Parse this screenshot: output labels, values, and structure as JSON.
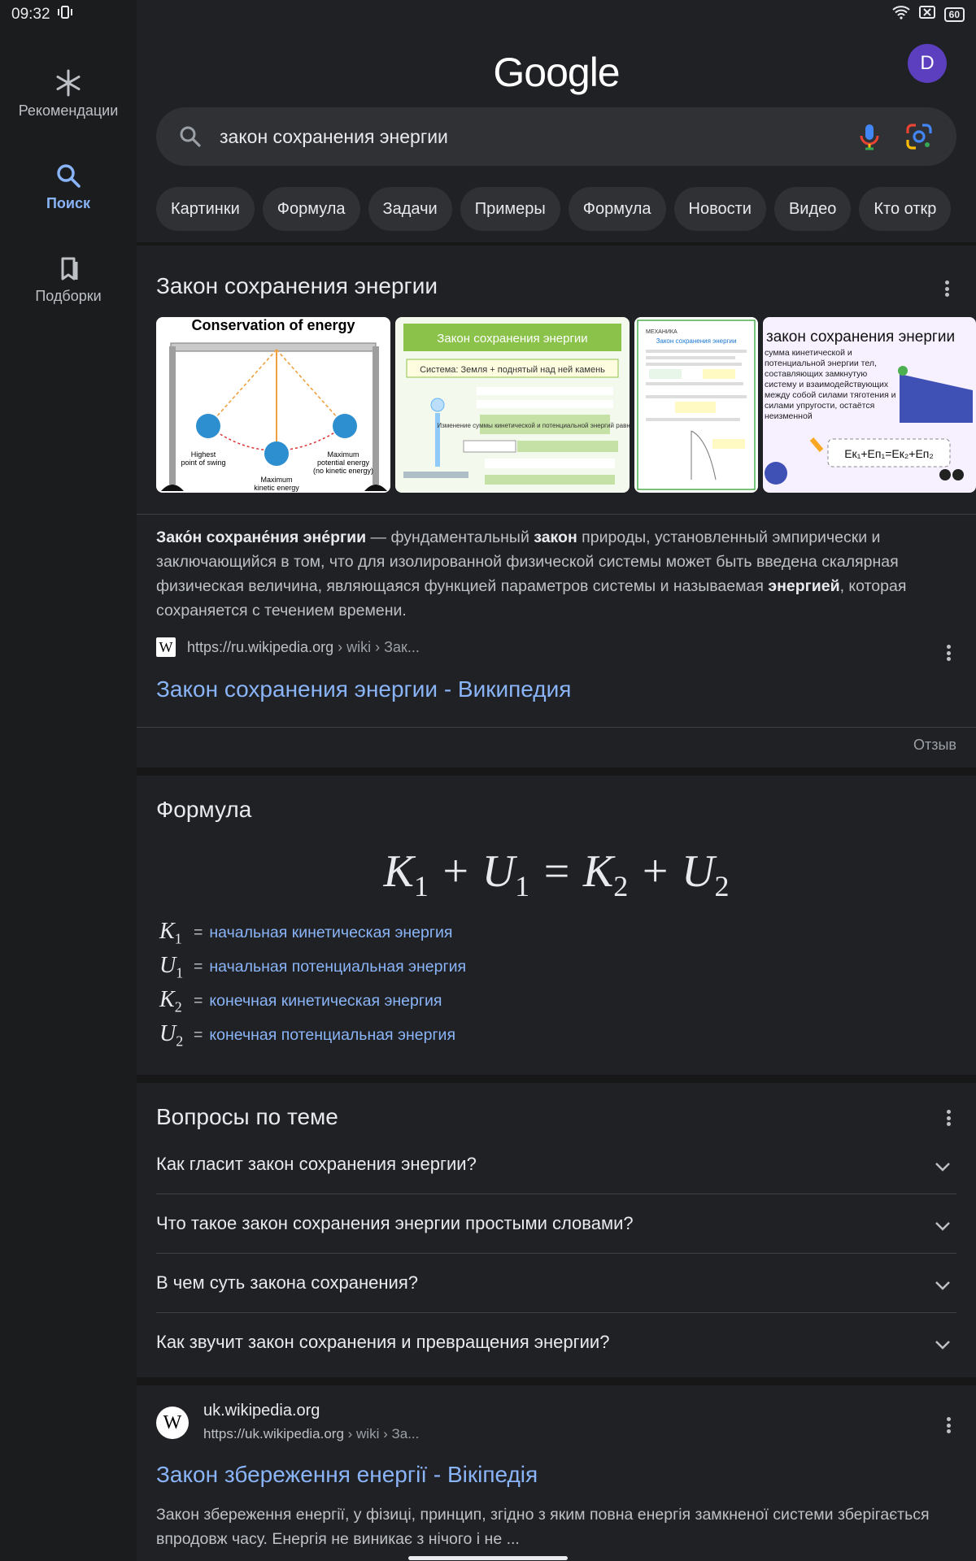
{
  "status_bar": {
    "time": "09:32",
    "battery": "60"
  },
  "rail": {
    "items": [
      {
        "label": "Рекомендации",
        "icon": "asterisk-icon",
        "active": false
      },
      {
        "label": "Поиск",
        "icon": "search-icon",
        "active": true
      },
      {
        "label": "Подборки",
        "icon": "bookmarks-icon",
        "active": false
      }
    ]
  },
  "header": {
    "logo": "Google",
    "avatar_letter": "D"
  },
  "search": {
    "query": "закон сохранения энергии"
  },
  "chips": [
    "Картинки",
    "Формула",
    "Задачи",
    "Примеры",
    "Формула",
    "Новости",
    "Видео",
    "Кто откр"
  ],
  "knowledge_panel": {
    "title": "Закон сохранения энергии",
    "images": {
      "img1_title": "Conservation of energy",
      "img1_labels": [
        "Highest point of swing",
        "Maximum potential energy (no kinetic energy)",
        "Maximum kinetic energy"
      ],
      "img2_title": "Закон сохранения энергии",
      "img2_system": "Система: Земля + поднятый над ней камень",
      "img2_note": "Изменение суммы кинетической и потенциальной энергий равно нулю.",
      "img3_header": "МЕХАНИКА",
      "img3_title": "Закон сохранения энергии",
      "img4_title": "закон сохранения энергии",
      "img4_text": "сумма кинетической и потенциальной энергии тел, составляющих замкнутую систему и взаимодействующих между собой силами тяготения и силами упругости, остаётся неизменной"
    },
    "description_parts": [
      {
        "b": "Зако́н сохране́ния эне́ргии"
      },
      {
        "t": " — фундаментальный "
      },
      {
        "b": "закон"
      },
      {
        "t": " природы, установленный эмпирически и заключающийся в том, что для изолированной физической системы может быть введена скалярная физическая величина, являющаяся функцией параметров системы и называемая "
      },
      {
        "b": "энергией"
      },
      {
        "t": ", которая сохраняется с течением времени."
      }
    ],
    "source_url": "https://ru.wikipedia.org",
    "source_crumb": " › wiki › Зак...",
    "result_title": "Закон сохранения энергии - Википедия",
    "feedback": "Отзыв"
  },
  "formula": {
    "title": "Формула",
    "variables": [
      {
        "sym": "K",
        "sub": "1",
        "def": "начальная кинетическая энергия"
      },
      {
        "sym": "U",
        "sub": "1",
        "def": "начальная потенциальная энергия"
      },
      {
        "sym": "K",
        "sub": "2",
        "def": "конечная кинетическая энергия"
      },
      {
        "sym": "U",
        "sub": "2",
        "def": "конечная потенциальная энергия"
      }
    ]
  },
  "questions": {
    "title": "Вопросы по теме",
    "items": [
      "Как гласит закон сохранения энергии?",
      "Что такое закон сохранения энергии простыми словами?",
      "В чем суть закона сохранения?",
      "Как звучит закон сохранения и превращения энергии?"
    ]
  },
  "result2": {
    "site": "uk.wikipedia.org",
    "url": "https://uk.wikipedia.org",
    "crumb": " › wiki › За...",
    "title": "Закон збереження енергії - Вікіпедія",
    "snippet": "Закон збереження енергії, у фізиці, принцип, згідно з яким повна енергія замкненої системи зберігається впродовж часу. Енергія не виникає з нічого і не ..."
  }
}
